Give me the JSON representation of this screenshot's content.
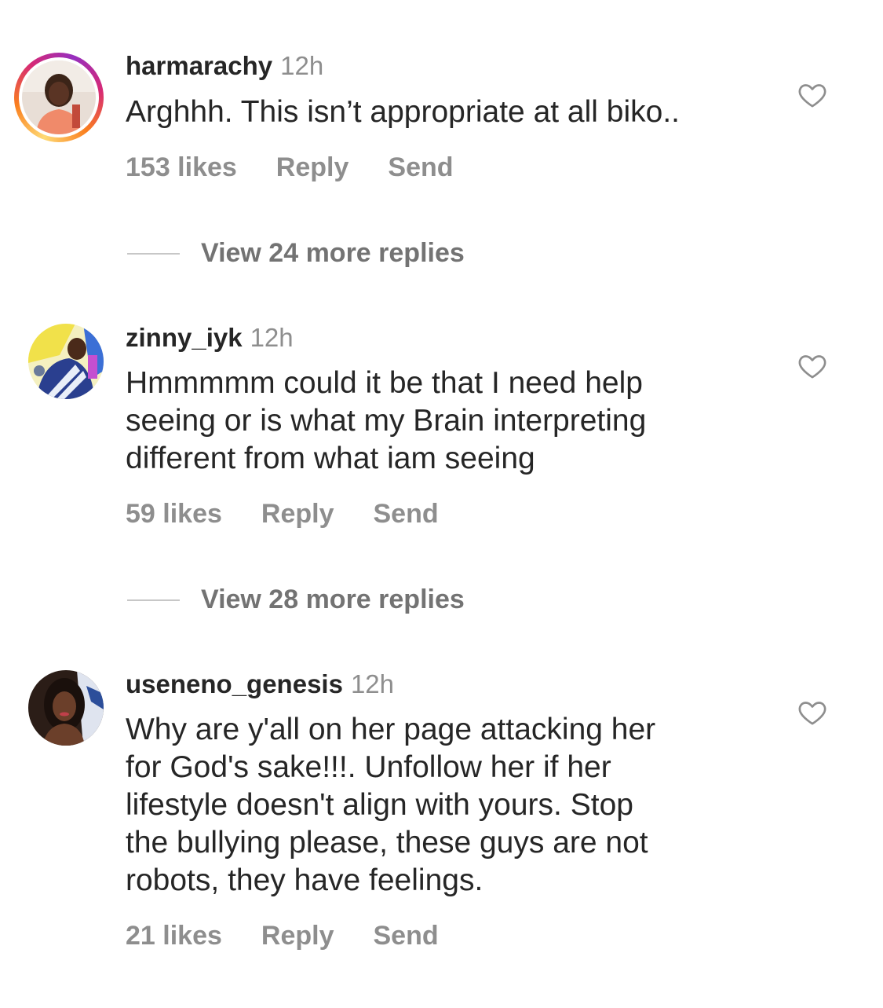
{
  "comments": [
    {
      "username": "harmarachy",
      "time": "12h",
      "text": "Arghhh. This isn’t appropriate at all biko..",
      "likes": "153 likes",
      "reply_label": "Reply",
      "send_label": "Send",
      "has_story_ring": true,
      "view_replies": "View 24 more replies"
    },
    {
      "username": "zinny_iyk",
      "time": "12h",
      "text_lines": [
        "Hmmmmm could it be that I need help",
        "seeing or is what my Brain interpreting",
        "different from what iam seeing"
      ],
      "likes": "59 likes",
      "reply_label": "Reply",
      "send_label": "Send",
      "has_story_ring": false,
      "view_replies": "View 28 more replies"
    },
    {
      "username": "useneno_genesis",
      "time": "12h",
      "text_lines": [
        "Why are y'all on her page attacking her",
        "for God's sake!!!. Unfollow her if her",
        "lifestyle doesn't align with yours. Stop",
        "the bullying please, these guys are not",
        "robots, they have feelings."
      ],
      "likes": "21 likes",
      "reply_label": "Reply",
      "send_label": "Send",
      "has_story_ring": false
    }
  ],
  "icons": {
    "like": "heart-outline-icon"
  },
  "colors": {
    "text": "#262626",
    "secondary": "#8e8e8e",
    "divider": "#c7c7c7"
  }
}
